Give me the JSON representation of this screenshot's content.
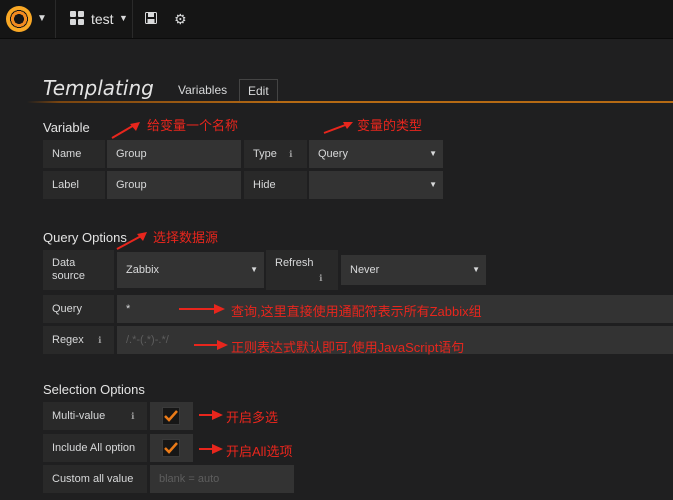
{
  "nav": {
    "dashboard_title": "test"
  },
  "header": {
    "title": "Templating",
    "tabs": [
      "Variables",
      "Edit"
    ]
  },
  "variable": {
    "section_title": "Variable",
    "name_label": "Name",
    "name_value": "Group",
    "type_label": "Type",
    "type_value": "Query",
    "label_label": "Label",
    "label_value": "Group",
    "hide_label": "Hide",
    "hide_value": ""
  },
  "query_options": {
    "section_title": "Query Options",
    "datasource_label": "Data\nsource",
    "datasource_value": "Zabbix",
    "refresh_label": "Refresh",
    "refresh_value": "Never",
    "query_label": "Query",
    "query_value": "*",
    "regex_label": "Regex",
    "regex_placeholder": "/.*-(.*)-.*/"
  },
  "selection_options": {
    "section_title": "Selection Options",
    "multi_label": "Multi-value",
    "multi_checked": true,
    "include_all_label": "Include All option",
    "include_all_checked": true,
    "custom_all_label": "Custom all value",
    "custom_all_placeholder": "blank = auto"
  },
  "annotations": {
    "name": "给变量一个名称",
    "type": "变量的类型",
    "datasource": "选择数据源",
    "query": "查询,这里直接使用通配符表示所有Zabbix组",
    "regex": "正则表达式默认即可,使用JavaScript语句",
    "multi": "开启多选",
    "include_all": "开启All选项"
  },
  "colors": {
    "accent_orange": "#eb7b18",
    "annotation_red": "#e8261d",
    "background": "#1f1f20"
  }
}
